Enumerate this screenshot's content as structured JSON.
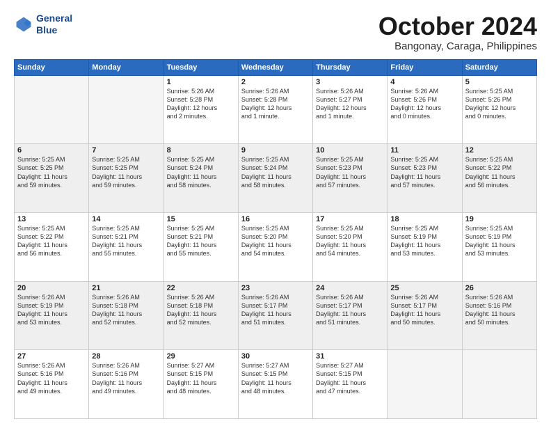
{
  "logo": {
    "line1": "General",
    "line2": "Blue"
  },
  "title": "October 2024",
  "subtitle": "Bangonay, Caraga, Philippines",
  "headers": [
    "Sunday",
    "Monday",
    "Tuesday",
    "Wednesday",
    "Thursday",
    "Friday",
    "Saturday"
  ],
  "weeks": [
    [
      {
        "day": "",
        "info": ""
      },
      {
        "day": "",
        "info": ""
      },
      {
        "day": "1",
        "info": "Sunrise: 5:26 AM\nSunset: 5:28 PM\nDaylight: 12 hours\nand 2 minutes."
      },
      {
        "day": "2",
        "info": "Sunrise: 5:26 AM\nSunset: 5:28 PM\nDaylight: 12 hours\nand 1 minute."
      },
      {
        "day": "3",
        "info": "Sunrise: 5:26 AM\nSunset: 5:27 PM\nDaylight: 12 hours\nand 1 minute."
      },
      {
        "day": "4",
        "info": "Sunrise: 5:26 AM\nSunset: 5:26 PM\nDaylight: 12 hours\nand 0 minutes."
      },
      {
        "day": "5",
        "info": "Sunrise: 5:25 AM\nSunset: 5:26 PM\nDaylight: 12 hours\nand 0 minutes."
      }
    ],
    [
      {
        "day": "6",
        "info": "Sunrise: 5:25 AM\nSunset: 5:25 PM\nDaylight: 11 hours\nand 59 minutes."
      },
      {
        "day": "7",
        "info": "Sunrise: 5:25 AM\nSunset: 5:25 PM\nDaylight: 11 hours\nand 59 minutes."
      },
      {
        "day": "8",
        "info": "Sunrise: 5:25 AM\nSunset: 5:24 PM\nDaylight: 11 hours\nand 58 minutes."
      },
      {
        "day": "9",
        "info": "Sunrise: 5:25 AM\nSunset: 5:24 PM\nDaylight: 11 hours\nand 58 minutes."
      },
      {
        "day": "10",
        "info": "Sunrise: 5:25 AM\nSunset: 5:23 PM\nDaylight: 11 hours\nand 57 minutes."
      },
      {
        "day": "11",
        "info": "Sunrise: 5:25 AM\nSunset: 5:23 PM\nDaylight: 11 hours\nand 57 minutes."
      },
      {
        "day": "12",
        "info": "Sunrise: 5:25 AM\nSunset: 5:22 PM\nDaylight: 11 hours\nand 56 minutes."
      }
    ],
    [
      {
        "day": "13",
        "info": "Sunrise: 5:25 AM\nSunset: 5:22 PM\nDaylight: 11 hours\nand 56 minutes."
      },
      {
        "day": "14",
        "info": "Sunrise: 5:25 AM\nSunset: 5:21 PM\nDaylight: 11 hours\nand 55 minutes."
      },
      {
        "day": "15",
        "info": "Sunrise: 5:25 AM\nSunset: 5:21 PM\nDaylight: 11 hours\nand 55 minutes."
      },
      {
        "day": "16",
        "info": "Sunrise: 5:25 AM\nSunset: 5:20 PM\nDaylight: 11 hours\nand 54 minutes."
      },
      {
        "day": "17",
        "info": "Sunrise: 5:25 AM\nSunset: 5:20 PM\nDaylight: 11 hours\nand 54 minutes."
      },
      {
        "day": "18",
        "info": "Sunrise: 5:25 AM\nSunset: 5:19 PM\nDaylight: 11 hours\nand 53 minutes."
      },
      {
        "day": "19",
        "info": "Sunrise: 5:25 AM\nSunset: 5:19 PM\nDaylight: 11 hours\nand 53 minutes."
      }
    ],
    [
      {
        "day": "20",
        "info": "Sunrise: 5:26 AM\nSunset: 5:19 PM\nDaylight: 11 hours\nand 53 minutes."
      },
      {
        "day": "21",
        "info": "Sunrise: 5:26 AM\nSunset: 5:18 PM\nDaylight: 11 hours\nand 52 minutes."
      },
      {
        "day": "22",
        "info": "Sunrise: 5:26 AM\nSunset: 5:18 PM\nDaylight: 11 hours\nand 52 minutes."
      },
      {
        "day": "23",
        "info": "Sunrise: 5:26 AM\nSunset: 5:17 PM\nDaylight: 11 hours\nand 51 minutes."
      },
      {
        "day": "24",
        "info": "Sunrise: 5:26 AM\nSunset: 5:17 PM\nDaylight: 11 hours\nand 51 minutes."
      },
      {
        "day": "25",
        "info": "Sunrise: 5:26 AM\nSunset: 5:17 PM\nDaylight: 11 hours\nand 50 minutes."
      },
      {
        "day": "26",
        "info": "Sunrise: 5:26 AM\nSunset: 5:16 PM\nDaylight: 11 hours\nand 50 minutes."
      }
    ],
    [
      {
        "day": "27",
        "info": "Sunrise: 5:26 AM\nSunset: 5:16 PM\nDaylight: 11 hours\nand 49 minutes."
      },
      {
        "day": "28",
        "info": "Sunrise: 5:26 AM\nSunset: 5:16 PM\nDaylight: 11 hours\nand 49 minutes."
      },
      {
        "day": "29",
        "info": "Sunrise: 5:27 AM\nSunset: 5:15 PM\nDaylight: 11 hours\nand 48 minutes."
      },
      {
        "day": "30",
        "info": "Sunrise: 5:27 AM\nSunset: 5:15 PM\nDaylight: 11 hours\nand 48 minutes."
      },
      {
        "day": "31",
        "info": "Sunrise: 5:27 AM\nSunset: 5:15 PM\nDaylight: 11 hours\nand 47 minutes."
      },
      {
        "day": "",
        "info": ""
      },
      {
        "day": "",
        "info": ""
      }
    ]
  ]
}
